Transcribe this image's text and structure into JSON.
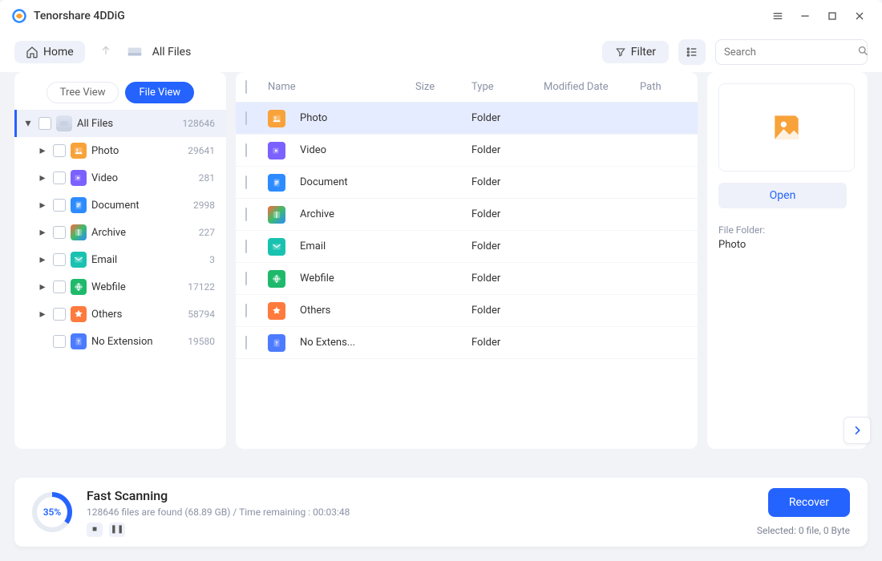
{
  "title": "Tenorshare 4DDiG",
  "toolbar": {
    "home": "Home",
    "breadcrumb": "All Files",
    "filter": "Filter",
    "search_placeholder": "Search"
  },
  "tabs": {
    "tree": "Tree View",
    "file": "File View"
  },
  "root": {
    "label": "All Files",
    "count": "128646"
  },
  "tree": [
    {
      "icon": "photo",
      "label": "Photo",
      "count": "29641"
    },
    {
      "icon": "video",
      "label": "Video",
      "count": "281"
    },
    {
      "icon": "doc",
      "label": "Document",
      "count": "2998"
    },
    {
      "icon": "archive",
      "label": "Archive",
      "count": "227"
    },
    {
      "icon": "email",
      "label": "Email",
      "count": "3"
    },
    {
      "icon": "webfile",
      "label": "Webfile",
      "count": "17122"
    },
    {
      "icon": "others",
      "label": "Others",
      "count": "58794"
    },
    {
      "icon": "noext",
      "label": "No Extension",
      "count": "19580",
      "leaf": true
    }
  ],
  "columns": {
    "name": "Name",
    "size": "Size",
    "type": "Type",
    "mod": "Modified Date",
    "path": "Path"
  },
  "rows": [
    {
      "icon": "photo",
      "name": "Photo",
      "type": "Folder",
      "selected": true
    },
    {
      "icon": "video",
      "name": "Video",
      "type": "Folder"
    },
    {
      "icon": "doc",
      "name": "Document",
      "type": "Folder"
    },
    {
      "icon": "archive",
      "name": "Archive",
      "type": "Folder"
    },
    {
      "icon": "email",
      "name": "Email",
      "type": "Folder"
    },
    {
      "icon": "webfile",
      "name": "Webfile",
      "type": "Folder"
    },
    {
      "icon": "others",
      "name": "Others",
      "type": "Folder"
    },
    {
      "icon": "noext",
      "name": "No Extens...",
      "type": "Folder"
    }
  ],
  "preview": {
    "open": "Open",
    "meta_label": "File Folder:",
    "meta_value": "Photo"
  },
  "footer": {
    "percent": "35%",
    "title": "Fast Scanning",
    "status": "128646 files are found (68.89 GB) /   Time remaining : 00:03:48",
    "recover": "Recover",
    "selected": "Selected: 0 file, 0 Byte"
  }
}
